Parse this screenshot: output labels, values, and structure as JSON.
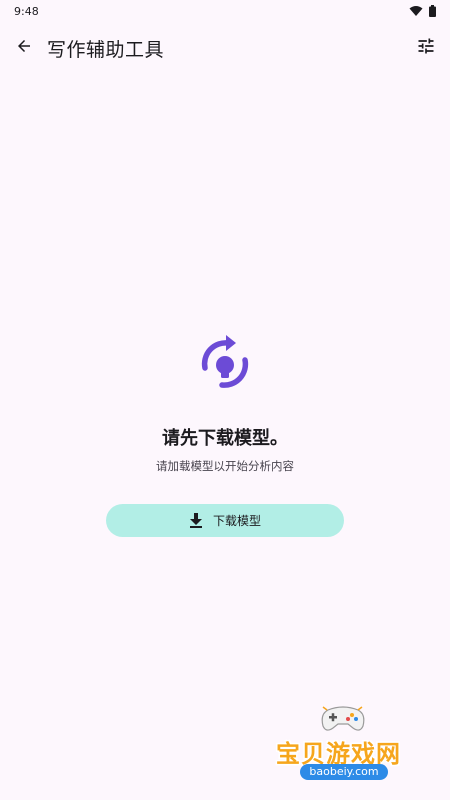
{
  "status_bar": {
    "time": "9:48",
    "icons": [
      "wifi-icon",
      "battery-icon"
    ]
  },
  "app_bar": {
    "title": "写作辅助工具",
    "back_icon": "arrow-back-icon",
    "settings_icon": "tune-icon"
  },
  "empty_state": {
    "icon": "bulb-refresh-icon",
    "title": "请先下载模型。",
    "subtitle": "请加载模型以开始分析内容"
  },
  "download_button": {
    "label": "下载模型",
    "icon": "download-icon"
  },
  "watermark": {
    "text": "宝贝游戏网",
    "url": "baobeiy.com"
  },
  "colors": {
    "background": "#FDF7FD",
    "accent": "#6C4BD6",
    "button_bg": "#B2EEE6",
    "watermark_orange": "#F6A61C",
    "watermark_blue": "#2D8BE7"
  }
}
